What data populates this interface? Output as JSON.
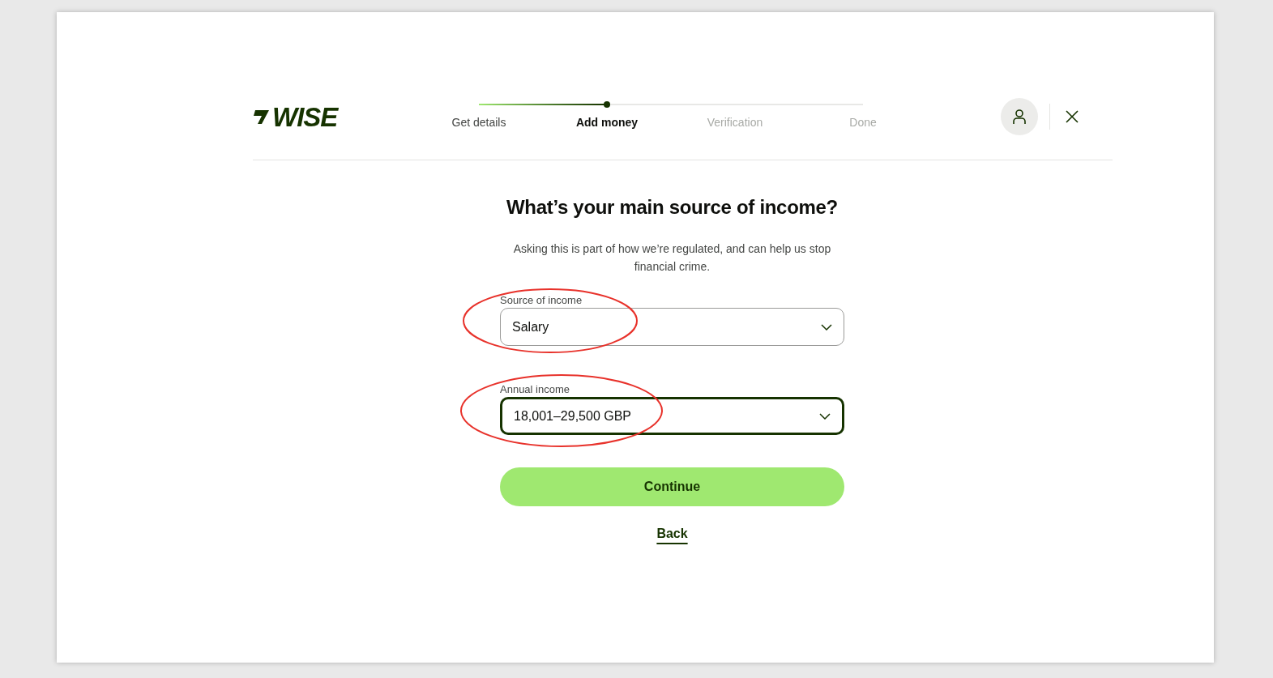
{
  "logo": {
    "text": "WISE"
  },
  "steps": [
    {
      "label": "Get details",
      "completed": true,
      "selected": false
    },
    {
      "label": "Add money",
      "completed": false,
      "selected": true
    },
    {
      "label": "Verification",
      "completed": false,
      "selected": false
    },
    {
      "label": "Done",
      "completed": false,
      "selected": false
    }
  ],
  "heading": "What’s your main source of income?",
  "subtitle": "Asking this is part of how we’re regulated, and can help us stop financial crime.",
  "fields": [
    {
      "label": "Source of income",
      "value": "Salary",
      "focused": false,
      "circled": true
    },
    {
      "label": "Annual income",
      "value": "18,001–29,500 GBP",
      "focused": true,
      "circled": true
    }
  ],
  "primary_button": "Continue",
  "back_link": "Back"
}
